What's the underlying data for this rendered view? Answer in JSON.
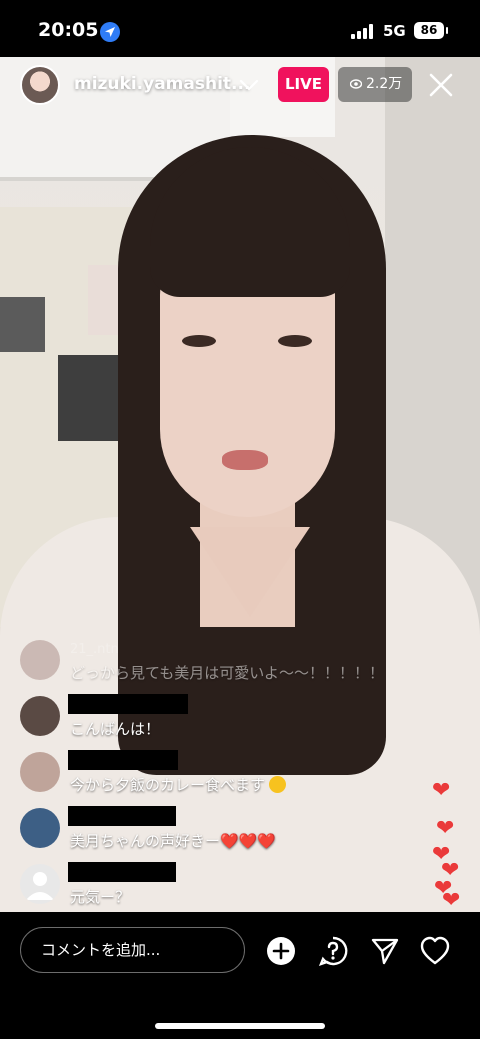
{
  "status_bar": {
    "time": "20:05",
    "network": "5G",
    "battery": "86"
  },
  "header": {
    "username": "mizuki.yamashit...",
    "live_label": "LIVE",
    "viewer_count": "2.2万"
  },
  "comments": [
    {
      "user": "21_.ntn",
      "text": "どっから見ても美月は可愛いよ〜〜！！！！！",
      "faded": true
    },
    {
      "user": "",
      "text": "こんばんは！"
    },
    {
      "user": "",
      "text": "今から夕飯のカレー食べます",
      "emoji": "grinning-squint-icon"
    },
    {
      "user": "",
      "text": "美月ちゃんの声好きー",
      "emoji": "heart-icon"
    },
    {
      "user": "",
      "text": "元気ー？"
    }
  ],
  "footer": {
    "comment_placeholder": "コメントを追加..."
  },
  "colors": {
    "live_badge": "#f0125d",
    "heart": "#ea3a3a",
    "accent_location": "#2f7cf6"
  }
}
